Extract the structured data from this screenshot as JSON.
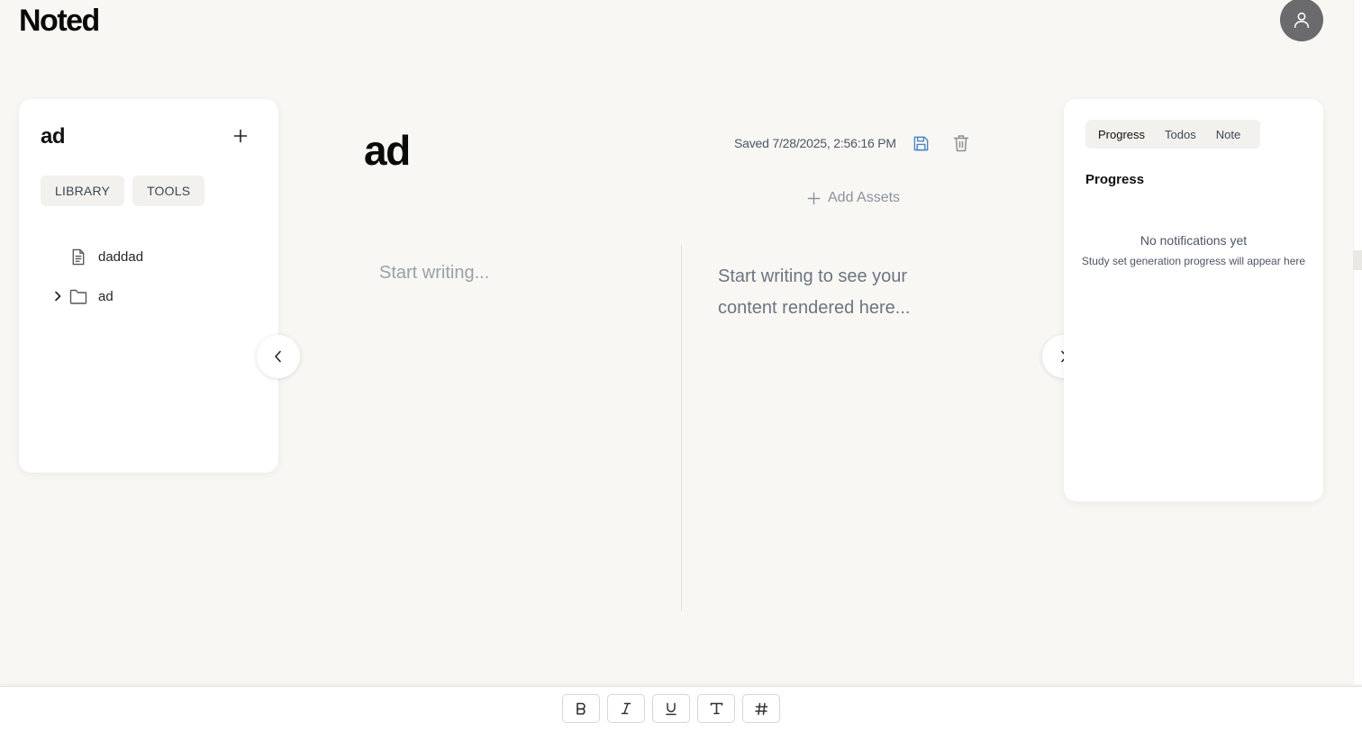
{
  "app": {
    "name": "Noted"
  },
  "library": {
    "title": "ad",
    "tabs": [
      "LIBRARY",
      "TOOLS"
    ],
    "items": [
      {
        "type": "file",
        "label": "daddad",
        "icon": "file-text-icon"
      },
      {
        "type": "folder",
        "label": "ad",
        "icon": "folder-icon",
        "expanded": false
      }
    ]
  },
  "editor": {
    "title": "ad",
    "saved_text": "Saved 7/28/2025, 2:56:16 PM",
    "add_assets_label": "Add Assets",
    "placeholder": "Start writing...",
    "preview_placeholder": "Start writing to see your content rendered here..."
  },
  "sidepanel": {
    "tabs": [
      "Progress",
      "Todos",
      "Note"
    ],
    "active_tab": "Progress",
    "heading": "Progress",
    "empty_title": "No notifications yet",
    "empty_subtitle": "Study set generation progress will appear here"
  },
  "toolbar": {
    "buttons": [
      {
        "name": "bold",
        "icon": "bold-icon"
      },
      {
        "name": "italic",
        "icon": "italic-icon"
      },
      {
        "name": "underline",
        "icon": "underline-icon"
      },
      {
        "name": "text",
        "icon": "type-icon"
      },
      {
        "name": "heading",
        "icon": "hash-icon"
      }
    ]
  },
  "colors": {
    "background": "#f8f7f4",
    "avatar": "#6b6b6e",
    "save_icon": "#4a86c5",
    "muted_text": "#8b919b"
  }
}
